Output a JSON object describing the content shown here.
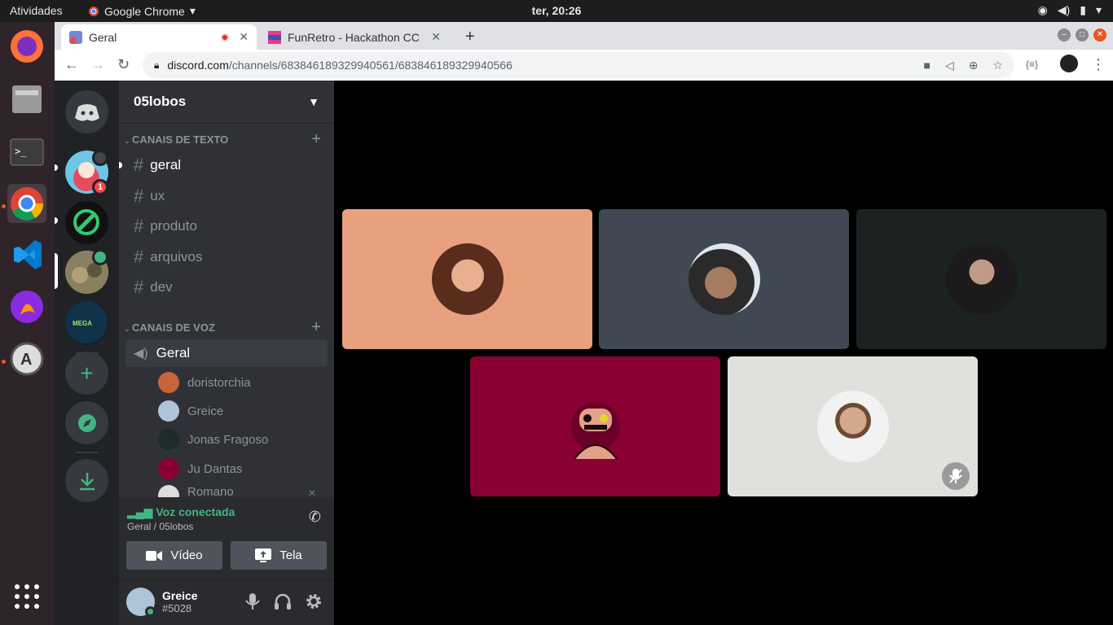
{
  "topbar": {
    "activities": "Atividades",
    "app_name": "Google Chrome",
    "clock": "ter, 20:26"
  },
  "browser": {
    "tabs": [
      {
        "title": "Geral"
      },
      {
        "title": "FunRetro - Hackathon CC"
      }
    ],
    "url_host": "discord.com",
    "url_path": "/channels/683846189329940561/683846189329940566"
  },
  "guild": {
    "name": "05lobos",
    "text_category": "CANAIS DE TEXTO",
    "text_channels": [
      "geral",
      "ux",
      "produto",
      "arquivos",
      "dev"
    ],
    "voice_category": "CANAIS DE VOZ",
    "voice_channel": "Geral",
    "voice_users": [
      "doristorchia",
      "Greice",
      "Jonas Fragoso",
      "Ju Dantas",
      "Romano"
    ]
  },
  "servers": {
    "badge": "1"
  },
  "voice_panel": {
    "status": "Voz conectada",
    "location": "Geral / 05lobos",
    "video_label": "Vídeo",
    "screen_label": "Tela"
  },
  "user": {
    "name": "Greice",
    "tag": "#5028"
  },
  "colors": {
    "tile1": "#e8a07e",
    "tile2": "#3f4853",
    "tile3": "#1c2121",
    "tile4": "#8a0033",
    "tile5": "#e0e0dc",
    "accent_green": "#43b581"
  }
}
